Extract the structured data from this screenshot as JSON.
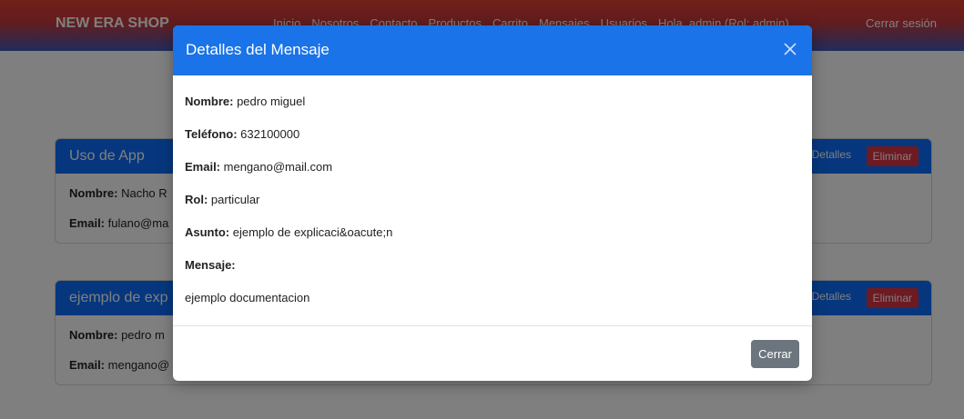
{
  "nav": {
    "brand": "NEW ERA SHOP",
    "links": [
      "Inicio",
      "Nosotros",
      "Contacto",
      "Productos",
      "Carrito",
      "Mensajes",
      "Usuarios",
      "Hola, admin (Rol: admin)"
    ],
    "logout": "Cerrar sesión"
  },
  "cards": [
    {
      "title": "Uso de App",
      "details_label": "Detalles",
      "delete_label": "Eliminar",
      "nombre_label": "Nombre:",
      "nombre": "Nacho R",
      "email_label": "Email:",
      "email": "fulano@ma"
    },
    {
      "title": "ejemplo de exp",
      "details_label": "Detalles",
      "delete_label": "Eliminar",
      "nombre_label": "Nombre:",
      "nombre": "pedro m",
      "email_label": "Email:",
      "email": "mengano@"
    }
  ],
  "modal": {
    "title": "Detalles del Mensaje",
    "fields": {
      "nombre_label": "Nombre:",
      "nombre": "pedro miguel",
      "telefono_label": "Teléfono:",
      "telefono": "632100000",
      "email_label": "Email:",
      "email": "mengano@mail.com",
      "rol_label": "Rol:",
      "rol": "particular",
      "asunto_label": "Asunto:",
      "asunto": "ejemplo de explicaci&oacute;n",
      "mensaje_label": "Mensaje:",
      "mensaje": "ejemplo documentacion"
    },
    "close_button": "Cerrar"
  },
  "colors": {
    "modal_header": "#1a73e8",
    "card_header": "#0d6efd",
    "delete_button": "#dc3545",
    "close_button": "#6c757d"
  }
}
